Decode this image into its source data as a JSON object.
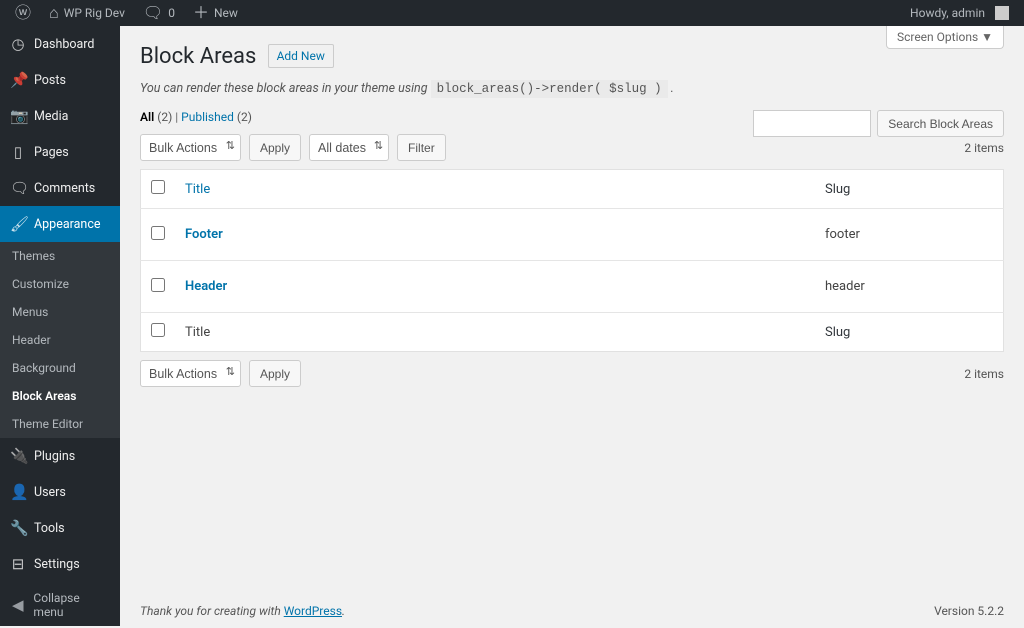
{
  "adminbar": {
    "site": "WP Rig Dev",
    "comments": "0",
    "new": "New",
    "howdy": "Howdy, admin"
  },
  "sidebar": {
    "dashboard": "Dashboard",
    "posts": "Posts",
    "media": "Media",
    "pages": "Pages",
    "comments": "Comments",
    "appearance": "Appearance",
    "plugins": "Plugins",
    "users": "Users",
    "tools": "Tools",
    "settings": "Settings",
    "collapse": "Collapse menu",
    "sub": {
      "themes": "Themes",
      "customize": "Customize",
      "menus": "Menus",
      "header": "Header",
      "background": "Background",
      "blockareas": "Block Areas",
      "themeeditor": "Theme Editor"
    }
  },
  "page": {
    "screen_options": "Screen Options ▼",
    "title": "Block Areas",
    "add_new": "Add New",
    "hint_pre": "You can render these block areas in your theme using ",
    "hint_code": "block_areas()->render( $slug )",
    "hint_post": " ."
  },
  "views": {
    "all_label": "All",
    "all_count": "(2)",
    "sep": "  |  ",
    "published_label": "Published",
    "published_count": "(2)"
  },
  "actions": {
    "bulk": "Bulk Actions",
    "apply": "Apply",
    "all_dates": "All dates",
    "filter": "Filter",
    "count": "2 items"
  },
  "search": {
    "button": "Search Block Areas"
  },
  "table": {
    "title": "Title",
    "slug": "Slug",
    "rows": [
      {
        "title": "Footer",
        "slug": "footer"
      },
      {
        "title": "Header",
        "slug": "header"
      }
    ]
  },
  "footer": {
    "thank_pre": "Thank you for creating with ",
    "wp": "WordPress",
    "thank_post": ".",
    "version": "Version 5.2.2"
  }
}
